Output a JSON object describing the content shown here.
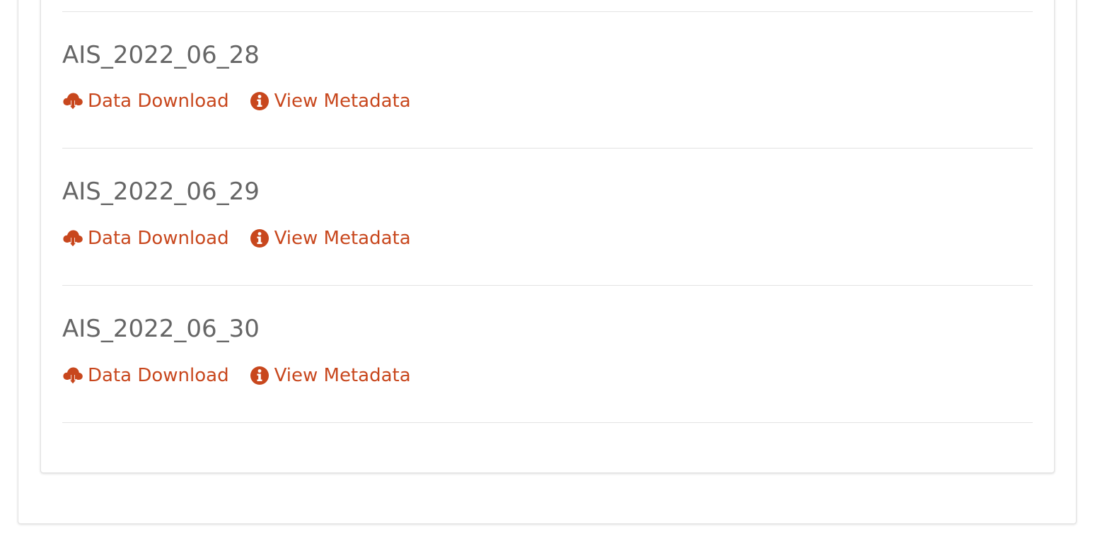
{
  "colors": {
    "link": "#c8471d",
    "title": "#666666",
    "divider": "#e3e3e3"
  },
  "datasets": [
    {
      "title": "AIS_2022_06_28",
      "download_label": "Data Download",
      "download_icon": "cloud-download-icon",
      "metadata_label": "View Metadata",
      "metadata_icon": "info-circle-icon"
    },
    {
      "title": "AIS_2022_06_29",
      "download_label": "Data Download",
      "download_icon": "cloud-download-icon",
      "metadata_label": "View Metadata",
      "metadata_icon": "info-circle-icon"
    },
    {
      "title": "AIS_2022_06_30",
      "download_label": "Data Download",
      "download_icon": "cloud-download-icon",
      "metadata_label": "View Metadata",
      "metadata_icon": "info-circle-icon"
    }
  ]
}
